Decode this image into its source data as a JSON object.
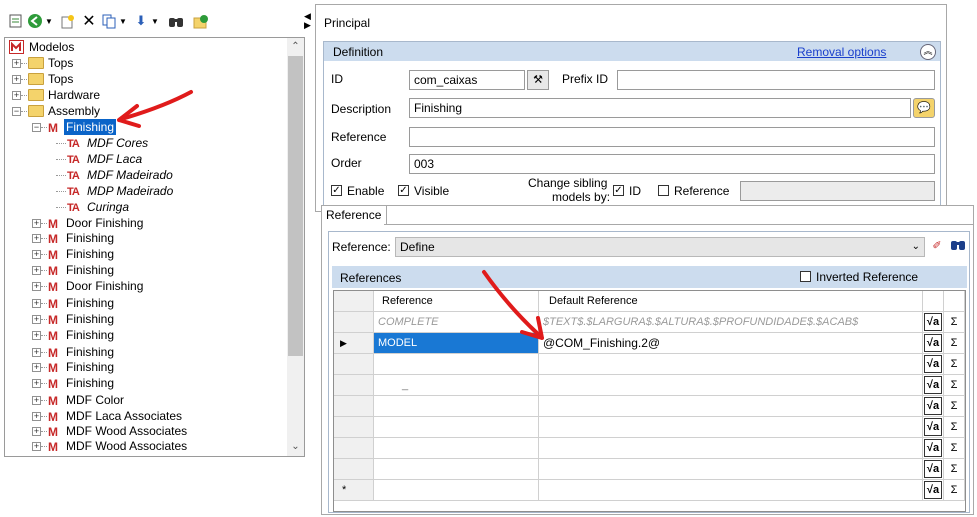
{
  "tree": {
    "root_label": "Modelos",
    "items": [
      {
        "label": "Tops",
        "kind": "folder"
      },
      {
        "label": "Tops",
        "kind": "folder"
      },
      {
        "label": "Hardware",
        "kind": "folder"
      },
      {
        "label": "Assembly",
        "kind": "folder"
      },
      {
        "label": "Finishing",
        "kind": "model",
        "selected": true
      },
      {
        "label": "MDF Cores",
        "kind": "text"
      },
      {
        "label": "MDF Laca",
        "kind": "text"
      },
      {
        "label": "MDF Madeirado",
        "kind": "text"
      },
      {
        "label": "MDP Madeirado",
        "kind": "text"
      },
      {
        "label": "Curinga",
        "kind": "text"
      },
      {
        "label": "Door Finishing",
        "kind": "model"
      },
      {
        "label": "Finishing",
        "kind": "model"
      },
      {
        "label": "Finishing",
        "kind": "model"
      },
      {
        "label": "Finishing",
        "kind": "model"
      },
      {
        "label": "Door Finishing",
        "kind": "model"
      },
      {
        "label": "Finishing",
        "kind": "model"
      },
      {
        "label": "Finishing",
        "kind": "model"
      },
      {
        "label": "Finishing",
        "kind": "model"
      },
      {
        "label": "Finishing",
        "kind": "model"
      },
      {
        "label": "Finishing",
        "kind": "model"
      },
      {
        "label": "Finishing",
        "kind": "model"
      },
      {
        "label": "MDF Color",
        "kind": "model"
      },
      {
        "label": "MDF Laca Associates",
        "kind": "model"
      },
      {
        "label": "MDF Wood Associates",
        "kind": "model"
      },
      {
        "label": "MDF Wood Associates",
        "kind": "model"
      }
    ]
  },
  "principal": {
    "tab_label": "Principal",
    "definition": {
      "header": "Definition",
      "removal_link": "Removal options",
      "id_label": "ID",
      "id_value": "com_caixas",
      "prefix_label": "Prefix ID",
      "prefix_value": "",
      "description_label": "Description",
      "description_value": "Finishing",
      "reference_label": "Reference",
      "reference_value": "",
      "order_label": "Order",
      "order_value": "003",
      "enable_label": "Enable",
      "visible_label": "Visible",
      "change_sibling_line1": "Change sibling",
      "change_sibling_line2": "models by:",
      "sibling_id_label": "ID",
      "sibling_ref_label": "Reference"
    }
  },
  "reference": {
    "tab_label": "Reference",
    "type_label": "Reference:",
    "type_value": "Define",
    "references_header": "References",
    "inverted_label": "Inverted Reference",
    "grid": {
      "col_reference": "Reference",
      "col_default": "Default Reference",
      "rows": [
        {
          "ref": "COMPLETE",
          "def": "$TEXT$.$LARGURA$.$ALTURA$.$PROFUNDIDADE$.$ACAB$"
        },
        {
          "ref": "MODEL",
          "def": "@COM_Finishing.2@"
        },
        {
          "ref": "",
          "def": ""
        },
        {
          "ref": "_",
          "def": ""
        },
        {
          "ref": "",
          "def": ""
        },
        {
          "ref": "",
          "def": ""
        },
        {
          "ref": "",
          "def": ""
        },
        {
          "ref": "",
          "def": ""
        },
        {
          "ref": "",
          "def": ""
        }
      ],
      "new_row_marker": "*",
      "sigma": "Σ"
    }
  }
}
